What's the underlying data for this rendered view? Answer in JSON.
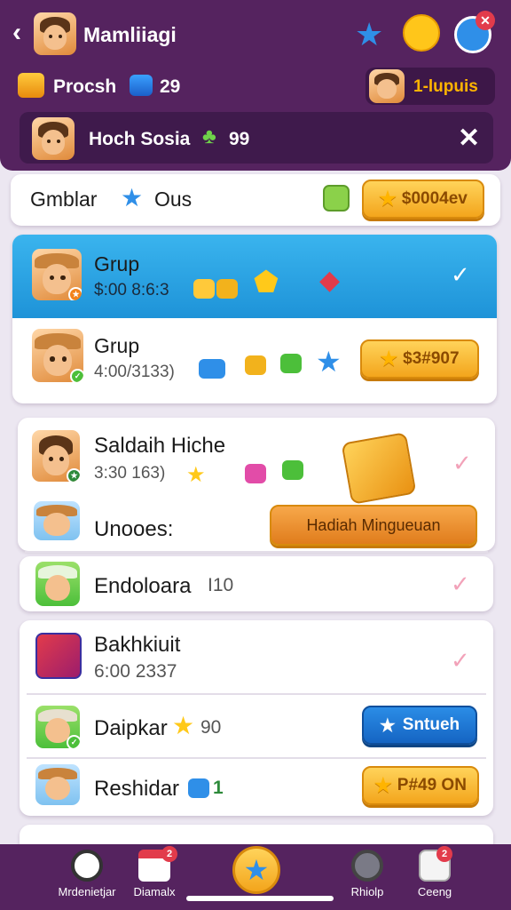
{
  "header": {
    "back_icon": "chevron-left-icon",
    "title": "Mamliiagi",
    "resource_label": "Procsh",
    "resource_value": "29",
    "level_label": "1-lupuis",
    "colors": {
      "bg": "#55235f",
      "accent": "#ffb400"
    }
  },
  "notice": {
    "name": "Hoch Sosia",
    "count": "99"
  },
  "search": {
    "label": "Gmblar",
    "label2": "Ous",
    "button_value": "$0004ev"
  },
  "groups": [
    {
      "name": "Grup",
      "sub": "$:00 8:6:3",
      "selected": true
    },
    {
      "name": "Grup",
      "sub": "4:00/3133)",
      "button": "$3#907"
    }
  ],
  "list": [
    {
      "name": "Saldaih Hiche",
      "sub": "3:30 163)"
    },
    {
      "name": "Unooes:",
      "button": "Hadiah Mingueuan"
    },
    {
      "name": "Endoloara",
      "sub": "I10"
    },
    {
      "name": "Bakhkiuit",
      "sub": "6:00 2337"
    },
    {
      "name": "Daipkar",
      "sub": "90",
      "button": "Sntueh"
    },
    {
      "name": "Reshidar",
      "sub": "1",
      "button": "P#49 ON"
    }
  ],
  "nav": [
    {
      "label": "Mrdenietjar",
      "icon": "film-reel-icon"
    },
    {
      "label": "Diamalx",
      "icon": "gift-calendar-icon",
      "badge": "2"
    },
    {
      "label": "",
      "icon": "star-icon"
    },
    {
      "label": "Rhiolp",
      "icon": "settings-gear-icon"
    },
    {
      "label": "Ceeng",
      "icon": "dice-icon",
      "badge": "2"
    }
  ]
}
